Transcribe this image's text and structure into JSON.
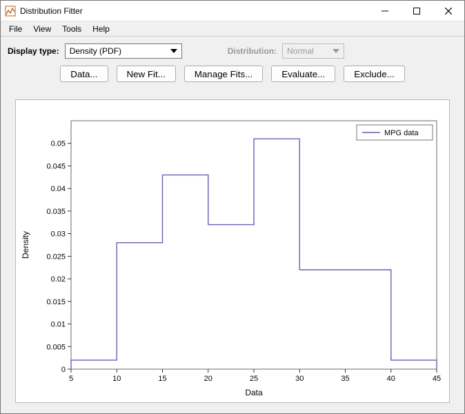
{
  "window": {
    "title": "Distribution Fitter"
  },
  "menubar": {
    "items": [
      "File",
      "View",
      "Tools",
      "Help"
    ]
  },
  "controls": {
    "display_label": "Display type:",
    "display_value": "Density (PDF)",
    "distribution_label": "Distribution:",
    "distribution_value": "Normal"
  },
  "buttons": {
    "data": "Data...",
    "new_fit": "New Fit...",
    "manage": "Manage Fits...",
    "evaluate": "Evaluate...",
    "exclude": "Exclude..."
  },
  "plot": {
    "xlabel": "Data",
    "ylabel": "Density",
    "legend": "MPG data"
  },
  "chart_data": {
    "type": "bar",
    "title": "",
    "xlabel": "Data",
    "ylabel": "Density",
    "xlim": [
      5,
      45
    ],
    "ylim": [
      0,
      0.055
    ],
    "categories": [
      "5–10",
      "10–15",
      "15–20",
      "20–25",
      "25–30",
      "30–35",
      "35–40",
      "40–45"
    ],
    "bin_edges": [
      5,
      10,
      15,
      20,
      25,
      30,
      35,
      40,
      45
    ],
    "values": [
      0.002,
      0.028,
      0.043,
      0.032,
      0.051,
      0.022,
      0.022,
      0.002
    ],
    "series_name": "MPG data",
    "series_color": "#6f5bb0",
    "x_ticks": [
      5,
      10,
      15,
      20,
      25,
      30,
      35,
      40,
      45
    ],
    "y_ticks": [
      0,
      0.005,
      0.01,
      0.015,
      0.02,
      0.025,
      0.03,
      0.035,
      0.04,
      0.045,
      0.05
    ],
    "grid": false,
    "legend_position": "upper right"
  }
}
